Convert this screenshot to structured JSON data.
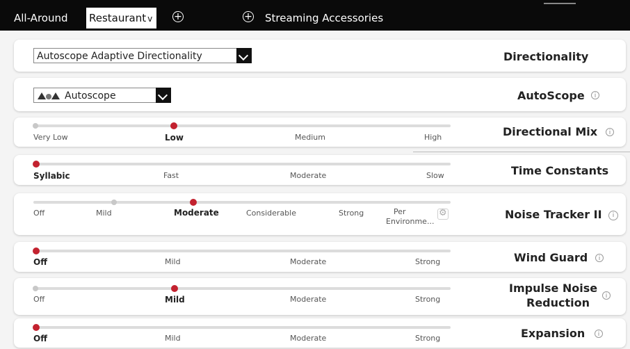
{
  "tabs": {
    "all_around": "All-Around",
    "restaurant": "Restaurant",
    "restaurant_chevron": "v",
    "streaming": "Streaming Accessories"
  },
  "colors": {
    "accent": "#c3222f",
    "topbar": "#0a0a0a"
  },
  "rows": {
    "directionality": {
      "label": "Directionality",
      "select_value": "Autoscope Adaptive Directionality"
    },
    "autoscope": {
      "label": "AutoScope",
      "select_value": "Autoscope",
      "icon": "autoscope-beam-icon"
    },
    "directional_mix": {
      "label": "Directional Mix",
      "options": [
        "Very Low",
        "Low",
        "Medium",
        "High"
      ],
      "selected": "Low"
    },
    "time_constants": {
      "label": "Time Constants",
      "options": [
        "Syllabic",
        "Fast",
        "Moderate",
        "Slow"
      ],
      "selected": "Syllabic"
    },
    "noise_tracker": {
      "label": "Noise Tracker II",
      "options": [
        "Off",
        "Mild",
        "Moderate",
        "Considerable",
        "Strong",
        "Per",
        "Environme..."
      ],
      "selected": "Moderate"
    },
    "wind_guard": {
      "label": "Wind Guard",
      "options": [
        "Off",
        "Mild",
        "Moderate",
        "Strong"
      ],
      "selected": "Off"
    },
    "impulse": {
      "label_line1": "Impulse Noise",
      "label_line2": "Reduction",
      "options": [
        "Off",
        "Mild",
        "Moderate",
        "Strong"
      ],
      "selected": "Mild"
    },
    "expansion": {
      "label": "Expansion",
      "options": [
        "Off",
        "Mild",
        "Moderate",
        "Strong"
      ],
      "selected": "Off"
    }
  }
}
